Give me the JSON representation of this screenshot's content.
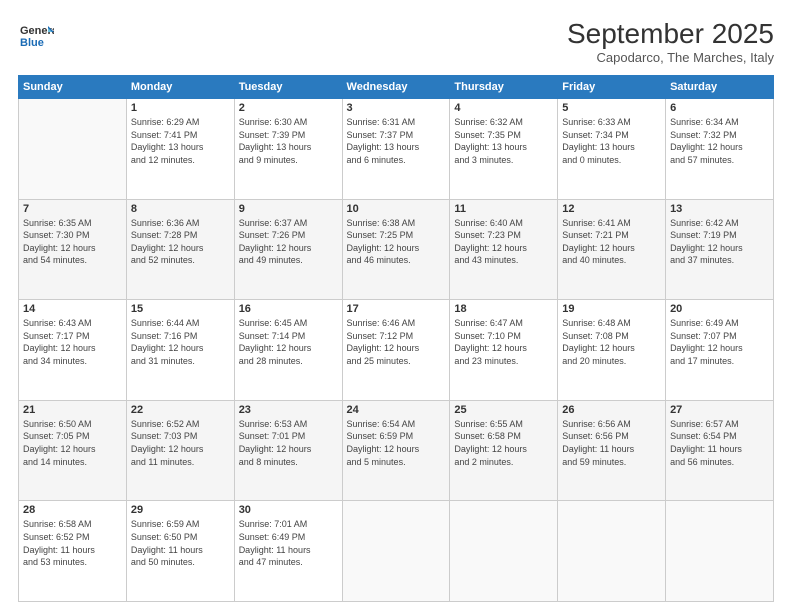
{
  "logo": {
    "line1": "General",
    "line2": "Blue"
  },
  "title": "September 2025",
  "subtitle": "Capodarco, The Marches, Italy",
  "weekdays": [
    "Sunday",
    "Monday",
    "Tuesday",
    "Wednesday",
    "Thursday",
    "Friday",
    "Saturday"
  ],
  "weeks": [
    [
      {
        "day": "",
        "info": ""
      },
      {
        "day": "1",
        "info": "Sunrise: 6:29 AM\nSunset: 7:41 PM\nDaylight: 13 hours\nand 12 minutes."
      },
      {
        "day": "2",
        "info": "Sunrise: 6:30 AM\nSunset: 7:39 PM\nDaylight: 13 hours\nand 9 minutes."
      },
      {
        "day": "3",
        "info": "Sunrise: 6:31 AM\nSunset: 7:37 PM\nDaylight: 13 hours\nand 6 minutes."
      },
      {
        "day": "4",
        "info": "Sunrise: 6:32 AM\nSunset: 7:35 PM\nDaylight: 13 hours\nand 3 minutes."
      },
      {
        "day": "5",
        "info": "Sunrise: 6:33 AM\nSunset: 7:34 PM\nDaylight: 13 hours\nand 0 minutes."
      },
      {
        "day": "6",
        "info": "Sunrise: 6:34 AM\nSunset: 7:32 PM\nDaylight: 12 hours\nand 57 minutes."
      }
    ],
    [
      {
        "day": "7",
        "info": "Sunrise: 6:35 AM\nSunset: 7:30 PM\nDaylight: 12 hours\nand 54 minutes."
      },
      {
        "day": "8",
        "info": "Sunrise: 6:36 AM\nSunset: 7:28 PM\nDaylight: 12 hours\nand 52 minutes."
      },
      {
        "day": "9",
        "info": "Sunrise: 6:37 AM\nSunset: 7:26 PM\nDaylight: 12 hours\nand 49 minutes."
      },
      {
        "day": "10",
        "info": "Sunrise: 6:38 AM\nSunset: 7:25 PM\nDaylight: 12 hours\nand 46 minutes."
      },
      {
        "day": "11",
        "info": "Sunrise: 6:40 AM\nSunset: 7:23 PM\nDaylight: 12 hours\nand 43 minutes."
      },
      {
        "day": "12",
        "info": "Sunrise: 6:41 AM\nSunset: 7:21 PM\nDaylight: 12 hours\nand 40 minutes."
      },
      {
        "day": "13",
        "info": "Sunrise: 6:42 AM\nSunset: 7:19 PM\nDaylight: 12 hours\nand 37 minutes."
      }
    ],
    [
      {
        "day": "14",
        "info": "Sunrise: 6:43 AM\nSunset: 7:17 PM\nDaylight: 12 hours\nand 34 minutes."
      },
      {
        "day": "15",
        "info": "Sunrise: 6:44 AM\nSunset: 7:16 PM\nDaylight: 12 hours\nand 31 minutes."
      },
      {
        "day": "16",
        "info": "Sunrise: 6:45 AM\nSunset: 7:14 PM\nDaylight: 12 hours\nand 28 minutes."
      },
      {
        "day": "17",
        "info": "Sunrise: 6:46 AM\nSunset: 7:12 PM\nDaylight: 12 hours\nand 25 minutes."
      },
      {
        "day": "18",
        "info": "Sunrise: 6:47 AM\nSunset: 7:10 PM\nDaylight: 12 hours\nand 23 minutes."
      },
      {
        "day": "19",
        "info": "Sunrise: 6:48 AM\nSunset: 7:08 PM\nDaylight: 12 hours\nand 20 minutes."
      },
      {
        "day": "20",
        "info": "Sunrise: 6:49 AM\nSunset: 7:07 PM\nDaylight: 12 hours\nand 17 minutes."
      }
    ],
    [
      {
        "day": "21",
        "info": "Sunrise: 6:50 AM\nSunset: 7:05 PM\nDaylight: 12 hours\nand 14 minutes."
      },
      {
        "day": "22",
        "info": "Sunrise: 6:52 AM\nSunset: 7:03 PM\nDaylight: 12 hours\nand 11 minutes."
      },
      {
        "day": "23",
        "info": "Sunrise: 6:53 AM\nSunset: 7:01 PM\nDaylight: 12 hours\nand 8 minutes."
      },
      {
        "day": "24",
        "info": "Sunrise: 6:54 AM\nSunset: 6:59 PM\nDaylight: 12 hours\nand 5 minutes."
      },
      {
        "day": "25",
        "info": "Sunrise: 6:55 AM\nSunset: 6:58 PM\nDaylight: 12 hours\nand 2 minutes."
      },
      {
        "day": "26",
        "info": "Sunrise: 6:56 AM\nSunset: 6:56 PM\nDaylight: 11 hours\nand 59 minutes."
      },
      {
        "day": "27",
        "info": "Sunrise: 6:57 AM\nSunset: 6:54 PM\nDaylight: 11 hours\nand 56 minutes."
      }
    ],
    [
      {
        "day": "28",
        "info": "Sunrise: 6:58 AM\nSunset: 6:52 PM\nDaylight: 11 hours\nand 53 minutes."
      },
      {
        "day": "29",
        "info": "Sunrise: 6:59 AM\nSunset: 6:50 PM\nDaylight: 11 hours\nand 50 minutes."
      },
      {
        "day": "30",
        "info": "Sunrise: 7:01 AM\nSunset: 6:49 PM\nDaylight: 11 hours\nand 47 minutes."
      },
      {
        "day": "",
        "info": ""
      },
      {
        "day": "",
        "info": ""
      },
      {
        "day": "",
        "info": ""
      },
      {
        "day": "",
        "info": ""
      }
    ]
  ]
}
